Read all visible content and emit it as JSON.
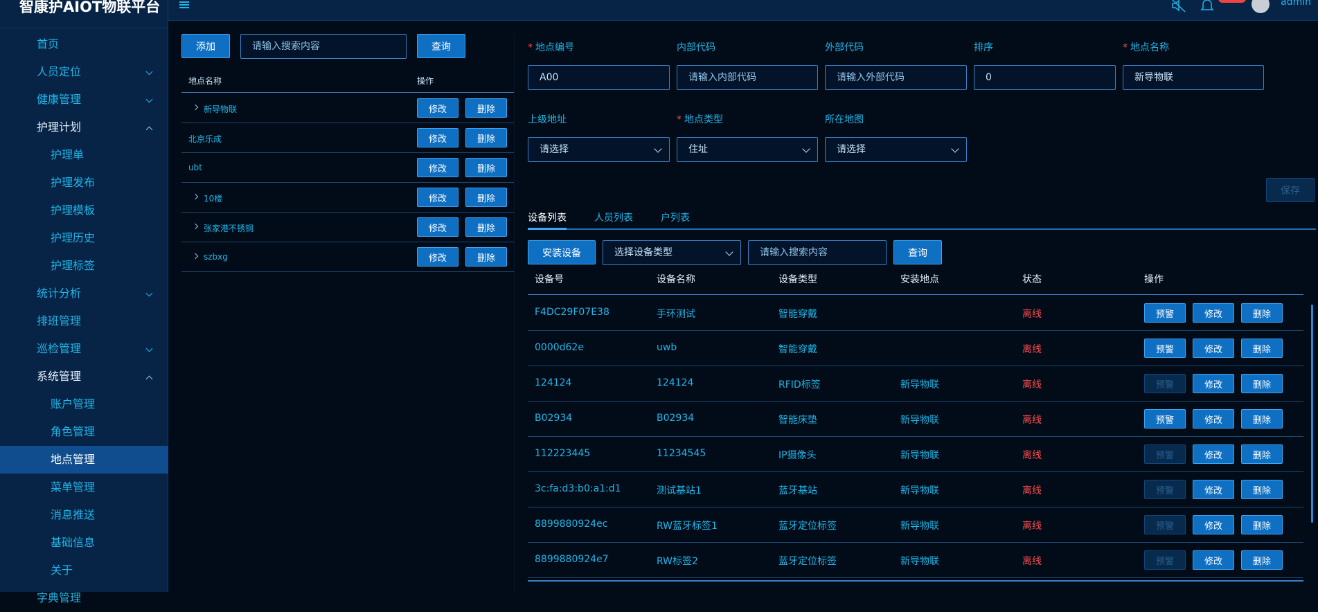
{
  "app": {
    "title": "智康护AIOT物联平台",
    "user": "admin"
  },
  "sidebar": {
    "items": [
      {
        "label": "首页",
        "level": 1,
        "expandable": false
      },
      {
        "label": "人员定位",
        "level": 1,
        "expandable": true,
        "open": false
      },
      {
        "label": "健康管理",
        "level": 1,
        "expandable": true,
        "open": false
      },
      {
        "label": "护理计划",
        "level": 1,
        "expandable": true,
        "open": true
      },
      {
        "label": "护理单",
        "level": 2
      },
      {
        "label": "护理发布",
        "level": 2
      },
      {
        "label": "护理模板",
        "level": 2
      },
      {
        "label": "护理历史",
        "level": 2
      },
      {
        "label": "护理标签",
        "level": 2
      },
      {
        "label": "统计分析",
        "level": 1,
        "expandable": true,
        "open": false
      },
      {
        "label": "排班管理",
        "level": 1,
        "expandable": false
      },
      {
        "label": "巡检管理",
        "level": 1,
        "expandable": true,
        "open": false
      },
      {
        "label": "系统管理",
        "level": 1,
        "expandable": true,
        "open": true
      },
      {
        "label": "账户管理",
        "level": 2
      },
      {
        "label": "角色管理",
        "level": 2
      },
      {
        "label": "地点管理",
        "level": 2,
        "active": true
      },
      {
        "label": "菜单管理",
        "level": 2
      },
      {
        "label": "消息推送",
        "level": 2
      },
      {
        "label": "基础信息",
        "level": 2
      },
      {
        "label": "关于",
        "level": 2
      },
      {
        "label": "字典管理",
        "level": 1
      }
    ]
  },
  "left": {
    "add_label": "添加",
    "search_placeholder": "请输入搜索内容",
    "query_label": "查询",
    "col_name": "地点名称",
    "col_ops": "操作",
    "edit_label": "修改",
    "delete_label": "删除",
    "rows": [
      {
        "name": "新导物联",
        "expandable": true
      },
      {
        "name": "北京乐成",
        "expandable": false
      },
      {
        "name": "ubt",
        "expandable": false
      },
      {
        "name": "10楼",
        "expandable": true
      },
      {
        "name": "张家港不锈钢",
        "expandable": true
      },
      {
        "name": "szbxg",
        "expandable": true
      }
    ]
  },
  "form": {
    "code_label": "地点编号",
    "code_value": "A00",
    "inner_label": "内部代码",
    "inner_placeholder": "请输入内部代码",
    "outer_label": "外部代码",
    "outer_placeholder": "请输入外部代码",
    "sort_label": "排序",
    "sort_value": "0",
    "name_label": "地点名称",
    "name_value": "新导物联",
    "parent_label": "上级地址",
    "parent_value": "请选择",
    "type_label": "地点类型",
    "type_value": "住址",
    "map_label": "所在地图",
    "map_value": "请选择",
    "save_label": "保存"
  },
  "tabs": [
    "设备列表",
    "人员列表",
    "户列表"
  ],
  "devices": {
    "install_label": "安装设备",
    "type_select": "选择设备类型",
    "search_placeholder": "请输入搜索内容",
    "query_label": "查询",
    "columns": [
      "设备号",
      "设备名称",
      "设备类型",
      "安装地点",
      "状态",
      "操作"
    ],
    "warn_label": "预警",
    "edit_label": "修改",
    "delete_label": "删除",
    "rows": [
      {
        "id": "F4DC29F07E38",
        "name": "手环测试",
        "type": "智能穿戴",
        "place": "",
        "status": "离线",
        "warn_enabled": true
      },
      {
        "id": "0000d62e",
        "name": "uwb",
        "type": "智能穿戴",
        "place": "",
        "status": "离线",
        "warn_enabled": true
      },
      {
        "id": "124124",
        "name": "124124",
        "type": "RFID标签",
        "place": "新导物联",
        "status": "离线",
        "warn_enabled": false
      },
      {
        "id": "B02934",
        "name": "B02934",
        "type": "智能床垫",
        "place": "新导物联",
        "status": "离线",
        "warn_enabled": true
      },
      {
        "id": "112223445",
        "name": "11234545",
        "type": "IP摄像头",
        "place": "新导物联",
        "status": "离线",
        "warn_enabled": false
      },
      {
        "id": "3c:fa:d3:b0:a1:d1",
        "name": "测试基站1",
        "type": "蓝牙基站",
        "place": "新导物联",
        "status": "离线",
        "warn_enabled": false
      },
      {
        "id": "8899880924ec",
        "name": "RW蓝牙标签1",
        "type": "蓝牙定位标签",
        "place": "新导物联",
        "status": "离线",
        "warn_enabled": false
      },
      {
        "id": "8899880924e7",
        "name": "RW标签2",
        "type": "蓝牙定位标签",
        "place": "新导物联",
        "status": "离线",
        "warn_enabled": false
      }
    ]
  }
}
